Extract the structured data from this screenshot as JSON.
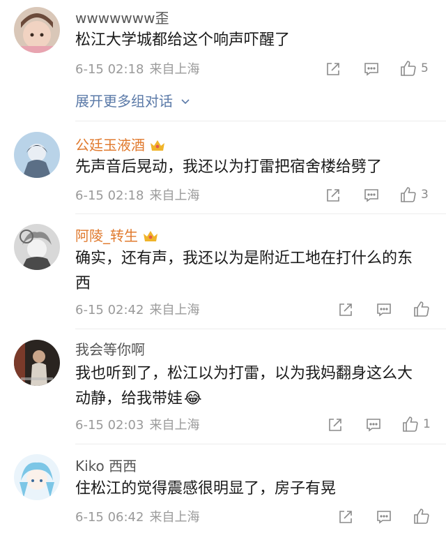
{
  "comments": [
    {
      "username": "wwwwwww歪",
      "text": "松江大学城都给这个响声吓醒了",
      "time": "6-15 02:18",
      "location": "来自上海",
      "likes": "5",
      "expand_label": "展开更多组对话"
    },
    {
      "username": "公廷玉液酒",
      "text": "先声音后晃动，我还以为打雷把宿舍楼给劈了",
      "time": "6-15 02:18",
      "location": "来自上海",
      "likes": "3"
    },
    {
      "username": "阿陵_转生",
      "text": "确实，还有声，我还以为是附近工地在打什么的东西",
      "time": "6-15 02:42",
      "location": "来自上海",
      "likes": ""
    },
    {
      "username": "我会等你啊",
      "text": "我也听到了，松江以为打雷，以为我妈翻身这么大动静，给我带娃",
      "emoji": "😂",
      "time": "6-15 02:03",
      "location": "来自上海",
      "likes": "1"
    },
    {
      "username": "Kiko 西西",
      "text": "住松江的觉得震感很明显了，房子有晃",
      "time": "6-15 06:42",
      "location": "来自上海",
      "likes": ""
    }
  ],
  "colors": {
    "vip_name": "#e07a2e",
    "normal_name": "#555555",
    "link": "#5b7aa8",
    "meta": "#9a9a9a",
    "crown": "#f0b42a"
  },
  "icons": {
    "forward": "share-square-icon",
    "reply": "comment-bubble-icon",
    "like": "thumbs-up-icon",
    "crown": "crown-icon",
    "expand": "chevron-down-icon"
  }
}
